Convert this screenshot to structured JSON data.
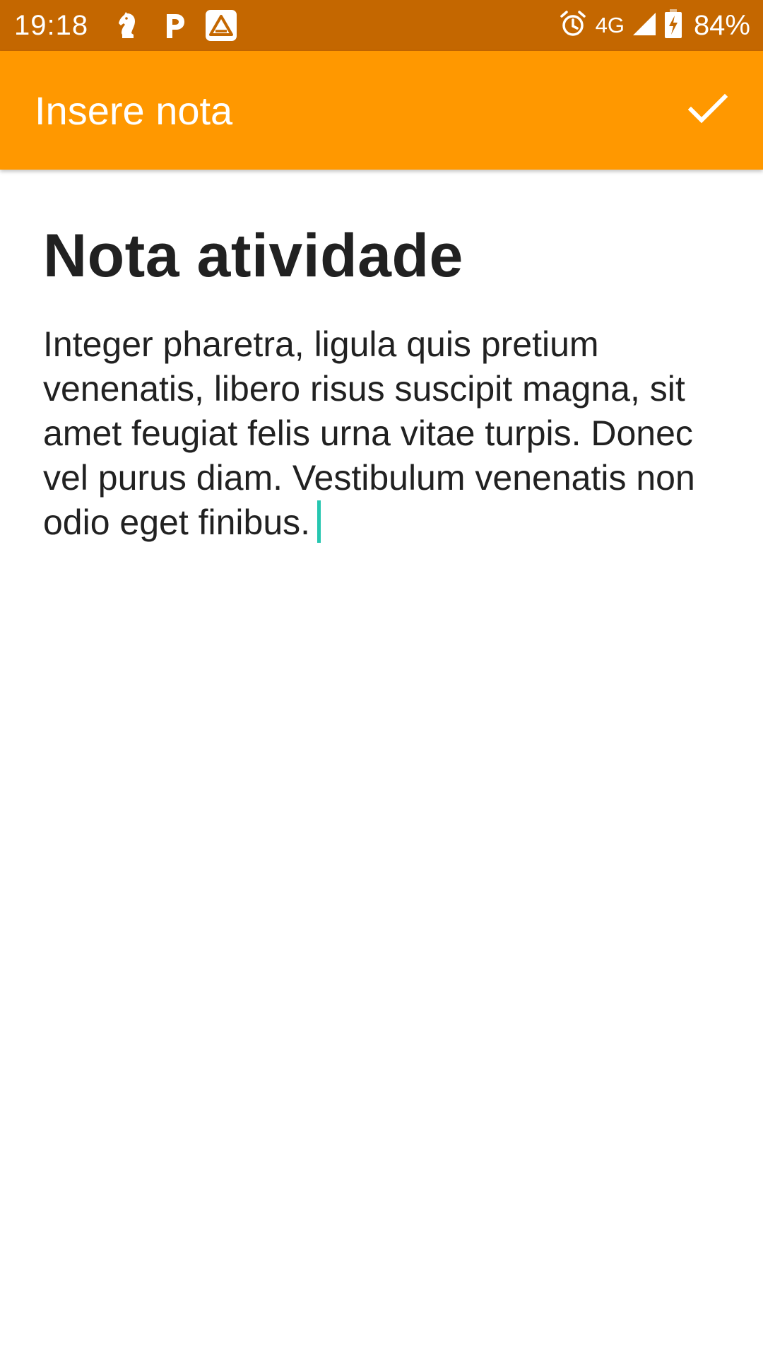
{
  "status_bar": {
    "time": "19:18",
    "network": "4G",
    "battery": "84%",
    "icons": [
      "chess-knight-icon",
      "parking-app-icon",
      "warning-app-icon",
      "alarm-icon",
      "signal-icon",
      "battery-charging-icon"
    ],
    "background": "#C46700"
  },
  "app_bar": {
    "title": "Insere nota",
    "action_icon": "check-icon",
    "background": "#FF9800"
  },
  "note": {
    "title": "Nota atividade",
    "body": "Integer pharetra, ligula quis pretium venenatis, libero risus suscipit magna, sit amet feugiat felis urna vitae turpis. Donec vel purus diam. Vestibulum venenatis non odio eget finibus.",
    "cursor_color": "#26C6B0"
  }
}
